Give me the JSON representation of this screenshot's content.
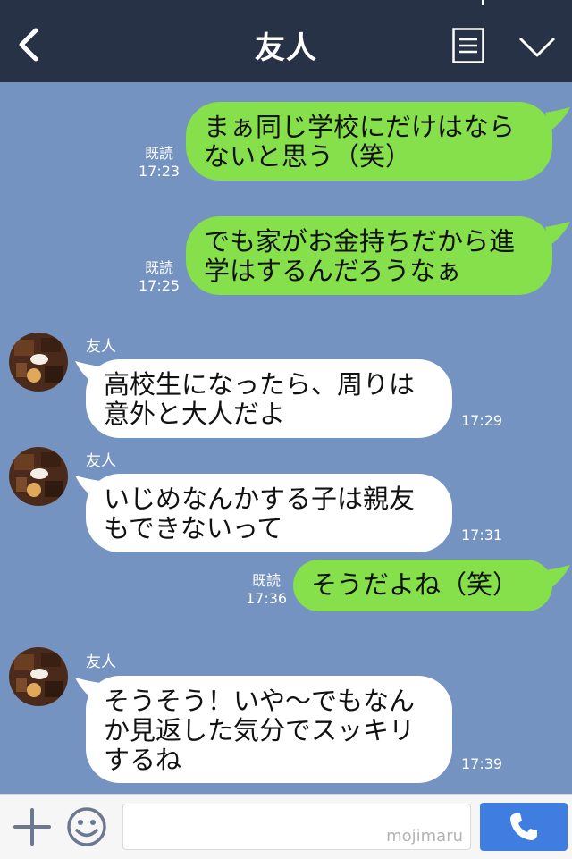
{
  "header": {
    "title": "友人"
  },
  "messages": [
    {
      "side": "sent",
      "text": "まぁ同じ学校にだけはならないと思う（笑）",
      "read": "既読",
      "time": "17:23"
    },
    {
      "side": "sent",
      "text": "でも家がお金持ちだから進学はするんだろうなぁ",
      "read": "既読",
      "time": "17:25"
    },
    {
      "side": "received",
      "sender": "友人",
      "text": "高校生になったら、周りは意外と大人だよ",
      "time": "17:29"
    },
    {
      "side": "received",
      "sender": "友人",
      "text": "いじめなんかする子は親友もできないって",
      "time": "17:31"
    },
    {
      "side": "sent",
      "text": "そうだよね（笑）",
      "read": "既読",
      "time": "17:36"
    },
    {
      "side": "received",
      "sender": "友人",
      "text": "そうそう！いや〜でもなんか見返した気分でスッキリするね",
      "time": "17:39"
    }
  ],
  "input": {
    "placeholder": "",
    "watermark": "mojimaru"
  },
  "colors": {
    "header_bg": "#273246",
    "chat_bg": "#7493c0",
    "sent_bubble": "#86e04b",
    "received_bubble": "#ffffff",
    "call_button": "#3f7ee0"
  },
  "icons": [
    "back-icon",
    "menu-icon",
    "chevron-down-icon",
    "plus-icon",
    "smile-icon",
    "phone-icon"
  ]
}
